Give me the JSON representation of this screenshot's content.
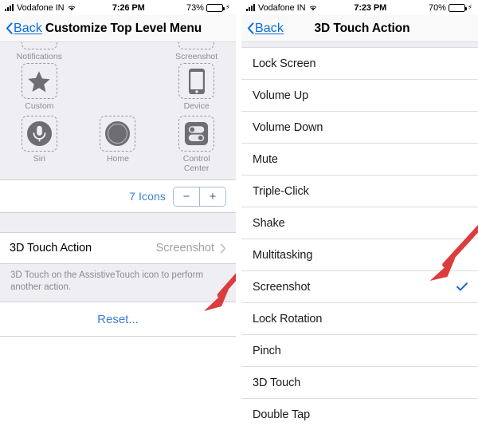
{
  "colors": {
    "accent_blue": "#3f7fd0",
    "link_blue": "#0a6cd8",
    "check_blue": "#0a5fd0",
    "arrow_red": "#dc3c3c",
    "battery_green": "#4cd964",
    "group_background": "#eeeef3",
    "row_background": "#ffffff",
    "separator": "#dcdce0",
    "secondary_text": "#8e8e93"
  },
  "left_screen": {
    "status_bar": {
      "signal_icon": "cellular-signal-icon",
      "carrier": "Vodafone IN",
      "wifi_icon": "wifi-icon",
      "time": "7:26 PM",
      "battery_percent": "73%",
      "battery_icon": "battery-icon",
      "charging_icon": "lightning-bolt-icon"
    },
    "nav": {
      "back_icon": "chevron-left-icon",
      "back_label": "Back",
      "title": "Customize Top Level Menu"
    },
    "icon_grid": [
      {
        "label": "Notifications",
        "icon": "notifications-icon",
        "clipped": true
      },
      {
        "label": "",
        "icon": "",
        "clipped": true,
        "empty": true
      },
      {
        "label": "Screenshot",
        "icon": "screenshot-icon",
        "clipped": true
      },
      {
        "label": "Custom",
        "icon": "star-icon",
        "clipped": false
      },
      {
        "label": "",
        "icon": "",
        "clipped": false,
        "empty": true
      },
      {
        "label": "Device",
        "icon": "device-icon",
        "clipped": false
      },
      {
        "label": "Siri",
        "icon": "siri-microphone-icon",
        "clipped": false
      },
      {
        "label": "Home",
        "icon": "home-button-icon",
        "clipped": false
      },
      {
        "label": "Control\nCenter",
        "icon": "control-center-icon",
        "clipped": false
      }
    ],
    "stepper": {
      "count_label": "7 Icons",
      "decrement_label": "−",
      "increment_label": "+"
    },
    "touch_action_row": {
      "label": "3D Touch Action",
      "value": "Screenshot",
      "disclosure_icon": "chevron-right-icon"
    },
    "footnote": "3D Touch on the AssistiveTouch icon to perform another action.",
    "reset_label": "Reset..."
  },
  "right_screen": {
    "status_bar": {
      "signal_icon": "cellular-signal-icon",
      "carrier": "Vodafone IN",
      "wifi_icon": "wifi-icon",
      "time": "7:23 PM",
      "battery_percent": "70%",
      "battery_icon": "battery-icon",
      "charging_icon": "lightning-bolt-icon"
    },
    "nav": {
      "back_icon": "chevron-left-icon",
      "back_label": "Back",
      "title": "3D Touch Action"
    },
    "options": [
      {
        "label": "Lock Screen",
        "selected": false
      },
      {
        "label": "Volume Up",
        "selected": false
      },
      {
        "label": "Volume Down",
        "selected": false
      },
      {
        "label": "Mute",
        "selected": false
      },
      {
        "label": "Triple-Click",
        "selected": false
      },
      {
        "label": "Shake",
        "selected": false
      },
      {
        "label": "Multitasking",
        "selected": false
      },
      {
        "label": "Screenshot",
        "selected": true
      },
      {
        "label": "Lock Rotation",
        "selected": false
      },
      {
        "label": "Pinch",
        "selected": false
      },
      {
        "label": "3D Touch",
        "selected": false
      },
      {
        "label": "Double Tap",
        "selected": false
      }
    ],
    "checkmark_icon": "checkmark-icon"
  },
  "annotations": {
    "left_arrow": "red-arrow-pointing-to-3d-touch-action-row",
    "right_arrow_left_branch": "red-arrow-pointing-to-screenshot-option",
    "right_arrow_right_branch": "red-arrow-pointing-to-checkmark"
  }
}
